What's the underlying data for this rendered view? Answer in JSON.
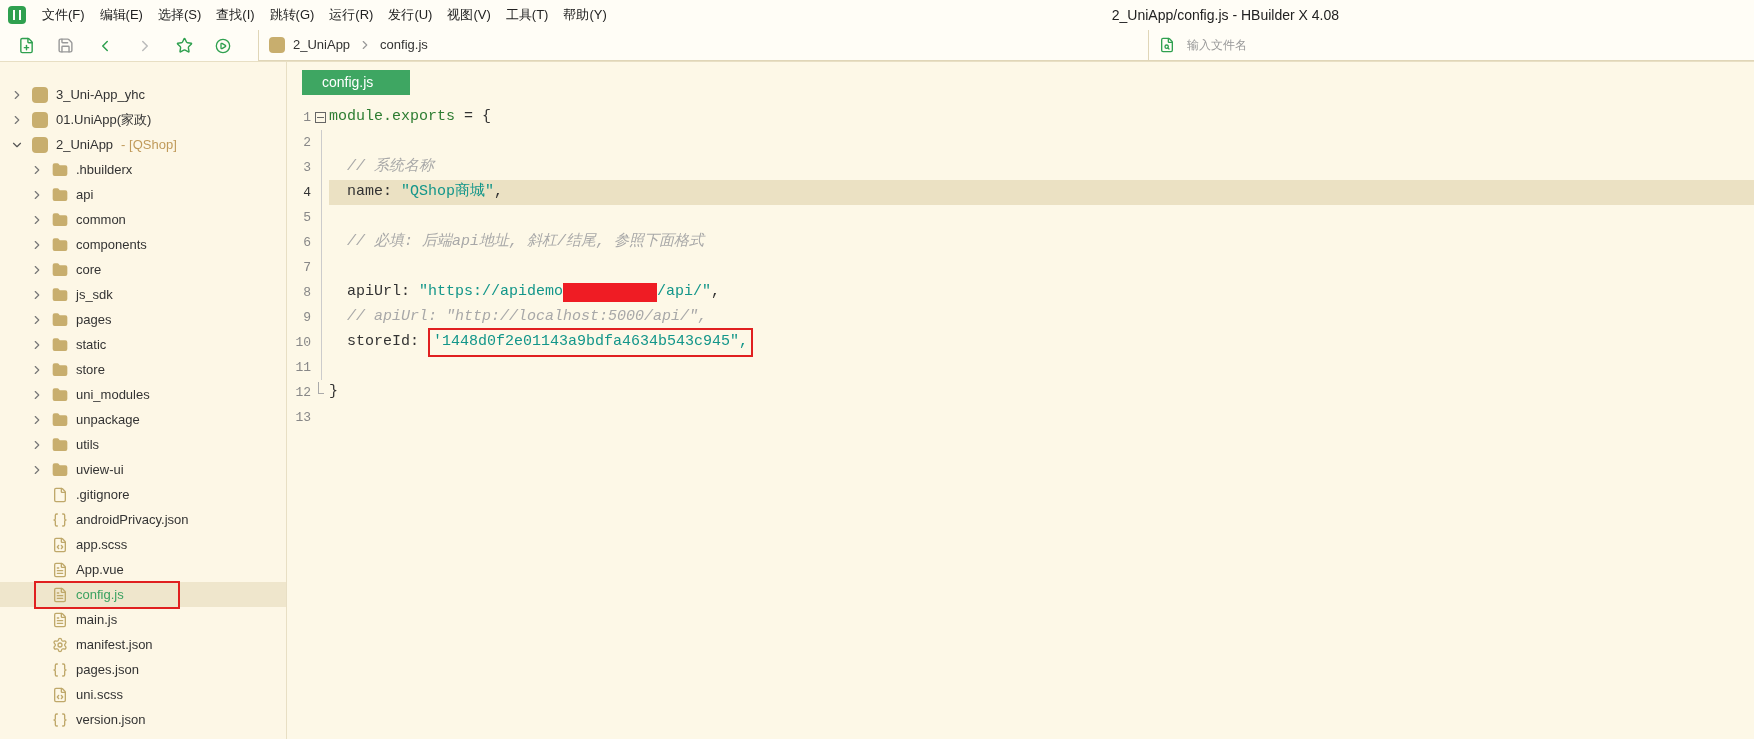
{
  "window": {
    "title": "2_UniApp/config.js - HBuilder X 4.08"
  },
  "menu": [
    "文件(F)",
    "编辑(E)",
    "选择(S)",
    "查找(I)",
    "跳转(G)",
    "运行(R)",
    "发行(U)",
    "视图(V)",
    "工具(T)",
    "帮助(Y)"
  ],
  "breadcrumb": [
    "2_UniApp",
    "config.js"
  ],
  "file_search": {
    "placeholder": "输入文件名"
  },
  "tree": [
    {
      "label": "3_Uni-App_yhc",
      "kind": "project",
      "expanded": false
    },
    {
      "label": "01.UniApp(家政)",
      "kind": "project",
      "expanded": false
    },
    {
      "label": "2_UniApp",
      "tag": "- [QShop]",
      "kind": "project",
      "expanded": true,
      "children": [
        {
          "label": ".hbuilderx",
          "kind": "folder",
          "expanded": false
        },
        {
          "label": "api",
          "kind": "folder",
          "expanded": false
        },
        {
          "label": "common",
          "kind": "folder",
          "expanded": false
        },
        {
          "label": "components",
          "kind": "folder",
          "expanded": false
        },
        {
          "label": "core",
          "kind": "folder",
          "expanded": false
        },
        {
          "label": "js_sdk",
          "kind": "folder",
          "expanded": false
        },
        {
          "label": "pages",
          "kind": "folder",
          "expanded": false
        },
        {
          "label": "static",
          "kind": "folder",
          "expanded": false
        },
        {
          "label": "store",
          "kind": "folder",
          "expanded": false
        },
        {
          "label": "uni_modules",
          "kind": "folder",
          "expanded": false
        },
        {
          "label": "unpackage",
          "kind": "folder",
          "expanded": false
        },
        {
          "label": "utils",
          "kind": "folder",
          "expanded": false
        },
        {
          "label": "uview-ui",
          "kind": "folder",
          "expanded": false
        },
        {
          "label": ".gitignore",
          "kind": "file",
          "selected": false
        },
        {
          "label": "androidPrivacy.json",
          "kind": "json",
          "selected": false
        },
        {
          "label": "app.scss",
          "kind": "scss",
          "selected": false
        },
        {
          "label": "App.vue",
          "kind": "vue",
          "selected": false
        },
        {
          "label": "config.js",
          "kind": "js",
          "selected": true,
          "annotated": true
        },
        {
          "label": "main.js",
          "kind": "js",
          "selected": false
        },
        {
          "label": "manifest.json",
          "kind": "manifest",
          "selected": false
        },
        {
          "label": "pages.json",
          "kind": "json",
          "selected": false
        },
        {
          "label": "uni.scss",
          "kind": "scss",
          "selected": false
        },
        {
          "label": "version.json",
          "kind": "json",
          "selected": false
        }
      ]
    }
  ],
  "tabs": [
    {
      "label": "config.js",
      "selected": true
    }
  ],
  "editor": {
    "lines": [
      {
        "number": "1",
        "fold_start": true,
        "current": false,
        "tokens": [
          {
            "kind": "keyword",
            "text": "module.exports"
          },
          {
            "kind": "plain",
            "text": " = {"
          }
        ],
        "children": [
          {
            "number": "2",
            "current": false
          },
          {
            "number": "3",
            "current": false,
            "tokens": [
              {
                "kind": "comment",
                "text": "// 系统名称"
              }
            ]
          },
          {
            "number": "4",
            "current": true,
            "tokens": [
              {
                "kind": "plain",
                "text": "name: "
              },
              {
                "kind": "string",
                "text": "\"QShop商城\""
              },
              {
                "kind": "plain",
                "text": ","
              }
            ]
          },
          {
            "number": "5",
            "current": false
          },
          {
            "number": "6",
            "current": false,
            "tokens": [
              {
                "kind": "comment",
                "text": "// 必填: 后端api地址, 斜杠/结尾, 参照下面格式"
              }
            ]
          },
          {
            "number": "7",
            "current": false
          },
          {
            "number": "8",
            "current": false,
            "tokens": [
              {
                "kind": "plain",
                "text": "apiUrl: "
              },
              {
                "kind": "string",
                "text": "\"https://apidemo"
              },
              {
                "kind": "redaction"
              },
              {
                "kind": "string",
                "text": "/api/\""
              },
              {
                "kind": "plain",
                "text": ","
              }
            ]
          },
          {
            "number": "9",
            "current": false,
            "tokens": [
              {
                "kind": "comment",
                "text": "// apiUrl: \"http://localhost:5000/api/\","
              }
            ]
          },
          {
            "number": "10",
            "current": false,
            "tokens": [
              {
                "kind": "plain",
                "text": "storeId: "
              },
              {
                "kind": "string",
                "text": "'1448d0f2e01143a9bdfa4634b543c945\",",
                "annotated": true
              }
            ]
          },
          {
            "number": "11",
            "current": false
          }
        ]
      },
      {
        "number": "12",
        "fold_end": true,
        "current": false,
        "tokens": [
          {
            "kind": "plain",
            "text": "}"
          }
        ]
      },
      {
        "number": "13",
        "current": false
      }
    ]
  }
}
